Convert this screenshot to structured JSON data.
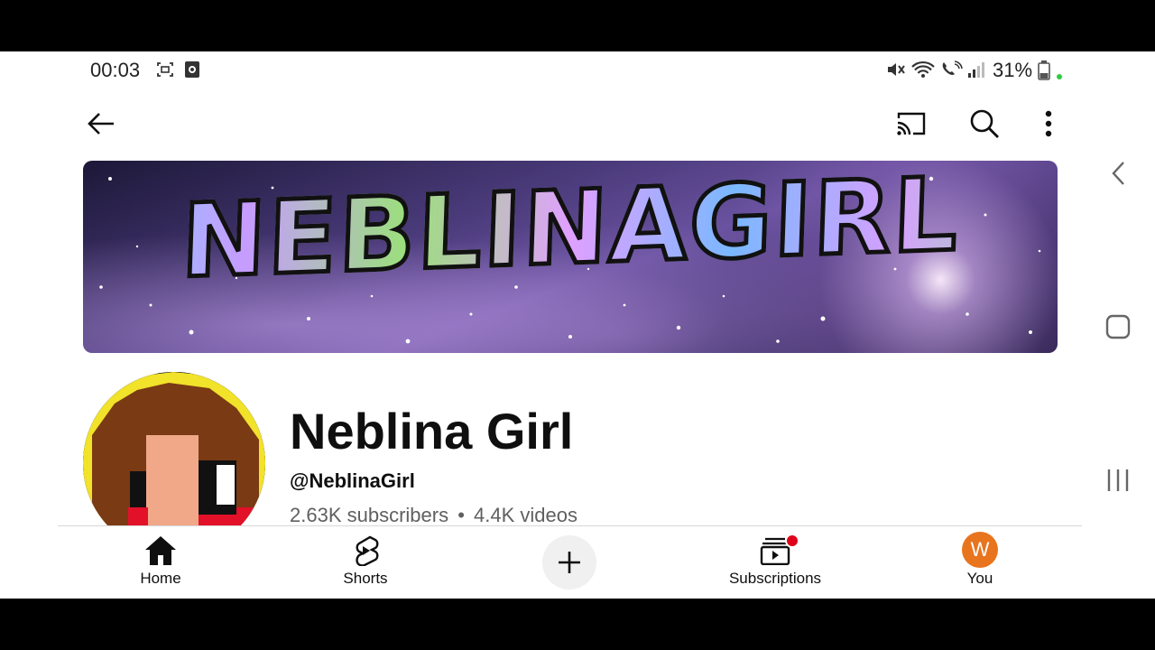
{
  "status_bar": {
    "time": "00:03",
    "battery": "31%"
  },
  "channel": {
    "banner_text": "NEBLINAGIRL",
    "name": "Neblina Girl",
    "handle": "@NeblinaGirl",
    "subscribers": "2.63K subscribers",
    "separator": "•",
    "videos": "4.4K videos"
  },
  "bottom_nav": {
    "home": "Home",
    "shorts": "Shorts",
    "subscriptions": "Subscriptions",
    "you": "You",
    "you_avatar_letter": "W"
  },
  "colors": {
    "you_avatar": "#e8741e",
    "notification_dot": "#e0001b"
  },
  "icons": [
    "back-arrow-icon",
    "cast-icon",
    "search-icon",
    "more-vert-icon",
    "home-icon",
    "shorts-icon",
    "plus-icon",
    "subscriptions-icon",
    "chevron-left-icon",
    "square-icon",
    "recent-apps-icon"
  ]
}
